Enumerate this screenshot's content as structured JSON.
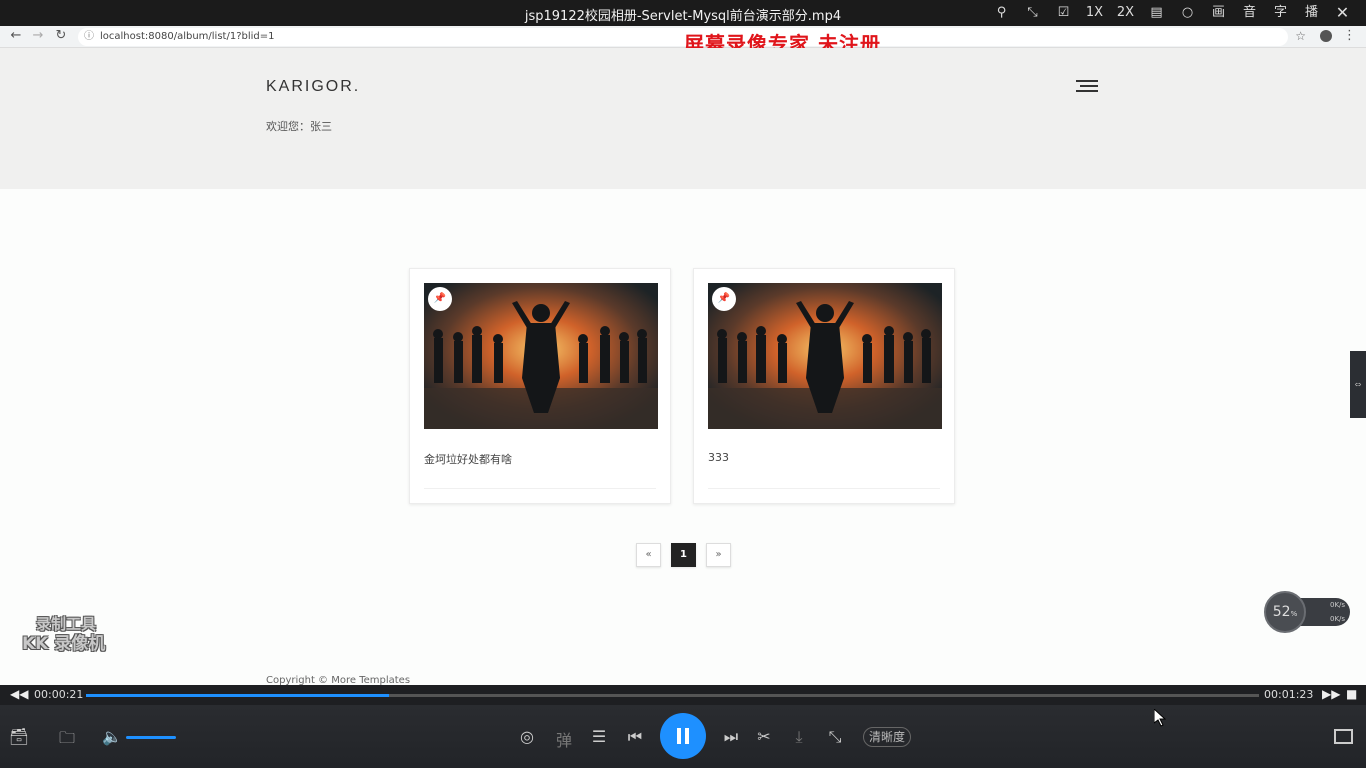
{
  "player": {
    "title": "jsp19122校园相册-Servlet-Mysql前台演示部分.mp4",
    "title_controls": [
      "pin-icon",
      "shrink-icon",
      "edit-icon",
      "1X",
      "2X",
      "layout-icon",
      "bulb-icon",
      "画",
      "音",
      "字",
      "播"
    ],
    "labels": {
      "speed1": "1X",
      "speed2": "2X",
      "picture": "画",
      "audio": "音",
      "subtitle": "字",
      "playlist": "播"
    },
    "close": "✕",
    "watermark": "屏幕录像专家  未注册",
    "kk_watermark": {
      "line1": "录制工具",
      "line2": "KK 录像机"
    },
    "current_time": "00:00:21",
    "total_time": "00:01:23",
    "progress": 0.258,
    "volume": 1.0,
    "danmaku": "弹",
    "clarity": "清晰度",
    "cpu_percent": "52",
    "cpu_unit": "%",
    "net_up": "0K/s",
    "net_down": "0K/s"
  },
  "browser": {
    "url": "localhost:8080/album/list/1?blid=1"
  },
  "site": {
    "logo": "KARIGOR.",
    "welcome": "欢迎您：张三",
    "albums": [
      {
        "caption": "金坷垃好处都有啥"
      },
      {
        "caption": "333"
      }
    ],
    "pager": {
      "prev": "«",
      "current": "1",
      "next": "»"
    },
    "copyright": "Copyright © More Templates"
  },
  "colors": {
    "accent": "#1e90ff",
    "watermark_red": "#e0151b"
  }
}
